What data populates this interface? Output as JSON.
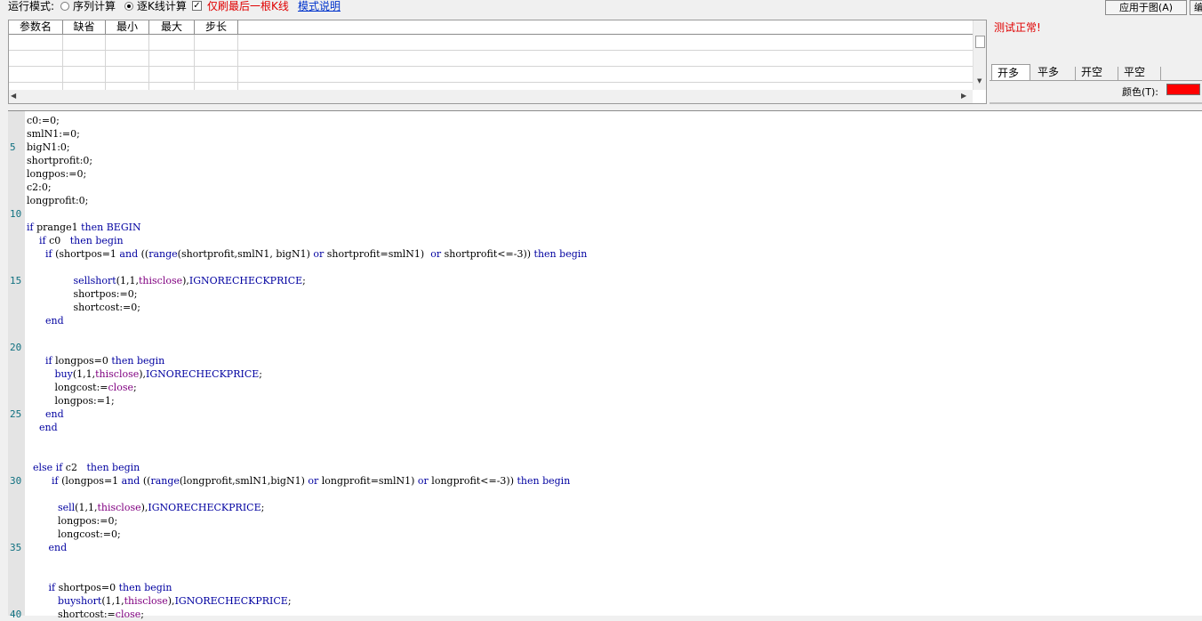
{
  "toolbar": {
    "run_mode_label": "运行模式:",
    "option_sequence": "序列计算",
    "option_per_bar": "逐K线计算",
    "selected_mode": "逐K线计算",
    "only_last_bar_label": "仅刷最后一根K线",
    "only_last_bar_checked": true,
    "mode_help_link": "模式说明",
    "apply_button": "应用于图(A)",
    "next_button": "编"
  },
  "params": {
    "columns": [
      "参数名",
      "缺省",
      "最小",
      "最大",
      "步长"
    ],
    "rows": []
  },
  "right_panel": {
    "status_text": "测试正常!",
    "tabs": [
      "开多",
      "平多",
      "开空",
      "平空"
    ],
    "active_tab": "开多",
    "color_label": "颜色(T):",
    "color_value": "#ff0000"
  },
  "editor": {
    "line_numbers": [
      {
        "n": "5"
      },
      {
        "n": "10"
      },
      {
        "n": "15"
      },
      {
        "n": "20"
      },
      {
        "n": "25"
      },
      {
        "n": "30"
      },
      {
        "n": "35"
      },
      {
        "n": "40"
      }
    ],
    "code": [
      "c0:=0;",
      "smlN1:=0;",
      "bigN1:0;",
      "shortprofit:0;",
      "longpos:=0;",
      "c2:0;",
      "longprofit:0;",
      "",
      "if prange1 then BEGIN",
      "    if c0   then begin",
      "      if (shortpos=1 and ((range(shortprofit,smlN1, bigN1) or shortprofit=smlN1)  or shortprofit<=-3)) then begin",
      "",
      "               sellshort(1,1,thisclose),IGNORECHECKPRICE;",
      "               shortpos:=0;",
      "               shortcost:=0;",
      "      end",
      "",
      "",
      "      if longpos=0 then begin",
      "         buy(1,1,thisclose),IGNORECHECKPRICE;",
      "         longcost:=close;",
      "         longpos:=1;",
      "      end",
      "    end",
      "",
      "",
      "  else if c2   then begin",
      "        if (longpos=1 and ((range(longprofit,smlN1,bigN1) or longprofit=smlN1) or longprofit<=-3)) then begin",
      "",
      "          sell(1,1,thisclose),IGNORECHECKPRICE;",
      "          longpos:=0;",
      "          longcost:=0;",
      "       end",
      "",
      "",
      "       if shortpos=0 then begin",
      "          buyshort(1,1,thisclose),IGNORECHECKPRICE;",
      "          shortcost:=close;"
    ]
  }
}
